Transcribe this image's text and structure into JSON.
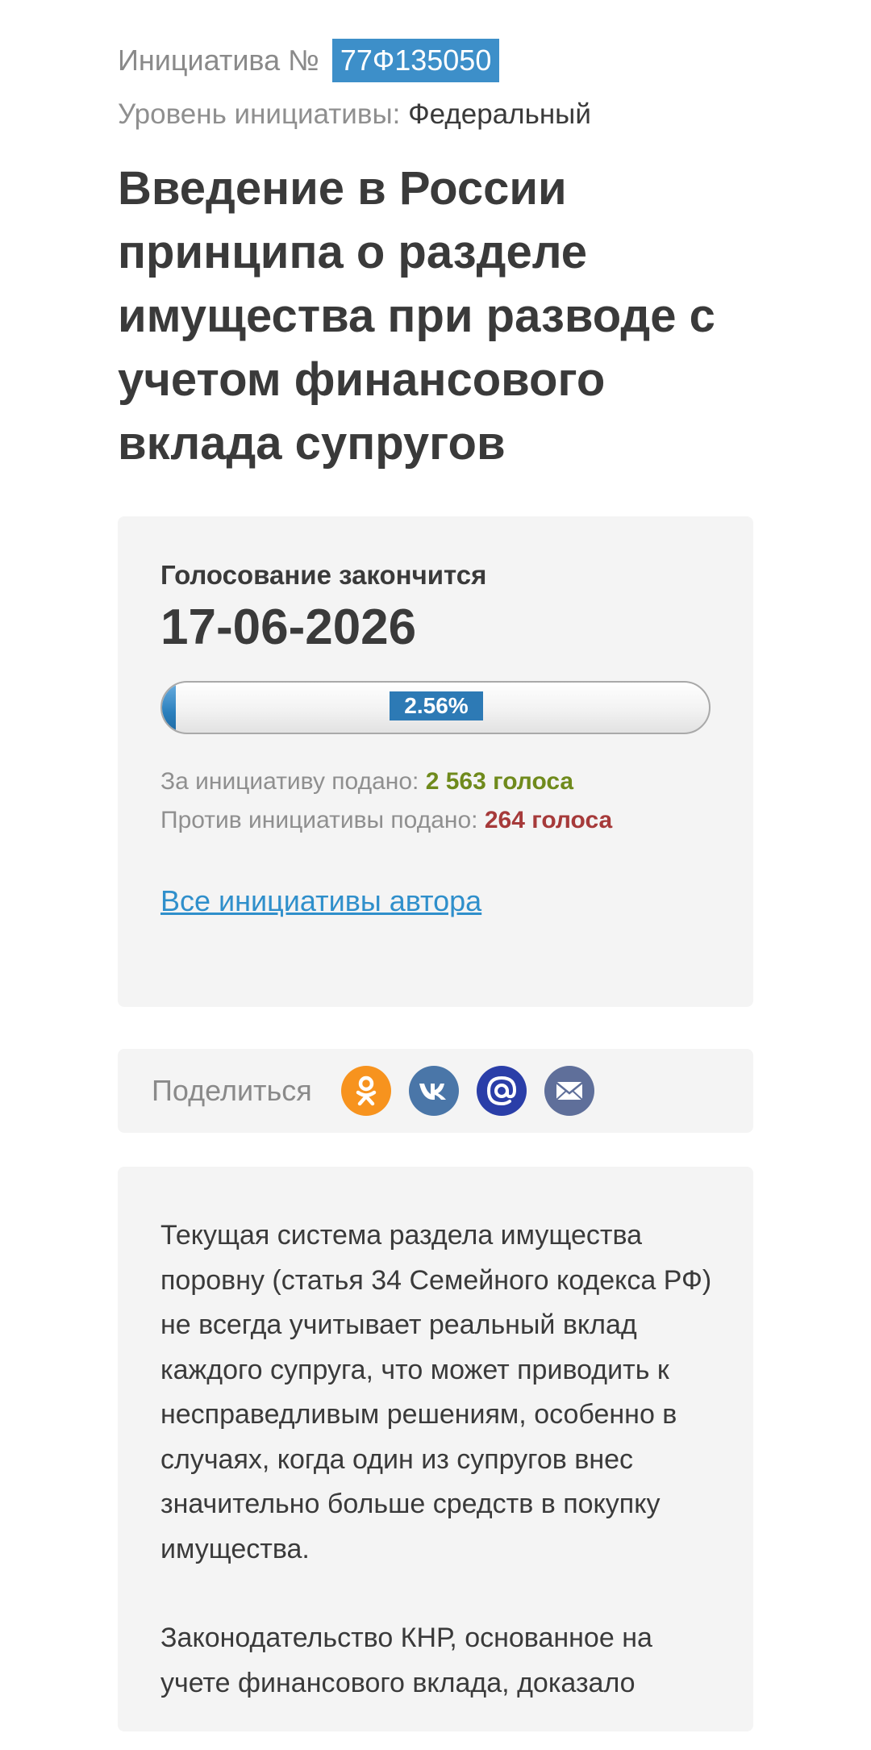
{
  "initiative": {
    "number_prefix": "Инициатива №",
    "number": "77Ф135050",
    "level_label": "Уровень инициативы:",
    "level_value": "Федеральный",
    "title": "Введение в России принципа о разделе имущества при разводе с учетом финансового вклада супругов"
  },
  "voting": {
    "ends_label": "Голосование закончится",
    "ends_date": "17-06-2026",
    "progress_percent": 2.56,
    "progress_label": "2.56%",
    "for_label": "За инициативу подано:",
    "for_value": "2 563 голоса",
    "against_label": "Против инициативы подано:",
    "against_value": "264 голоса",
    "author_link": "Все инициативы автора"
  },
  "share": {
    "label": "Поделиться",
    "icons": [
      {
        "name": "odnoklassniki-icon",
        "color": "#f7931e"
      },
      {
        "name": "vk-icon",
        "color": "#4a76a8"
      },
      {
        "name": "mailru-icon",
        "color": "#2a3ea8"
      },
      {
        "name": "email-icon",
        "color": "#5f6f9a"
      }
    ]
  },
  "description": {
    "paragraphs": [
      "Текущая система раздела имущества поровну (статья 34 Семейного кодекса РФ) не всегда учитывает реальный вклад каждого супруга, что может приводить к несправедливым решениям, особенно в случаях, когда один из супругов внес значительно больше средств в покупку имущества.",
      "Законодательство КНР, основанное на учете финансового вклада, доказало"
    ]
  },
  "colors": {
    "accent": "#3d8fc9",
    "for": "#6f8a1c",
    "against": "#a63a3a",
    "link": "#2f8fcb",
    "card_bg": "#f4f4f4"
  }
}
